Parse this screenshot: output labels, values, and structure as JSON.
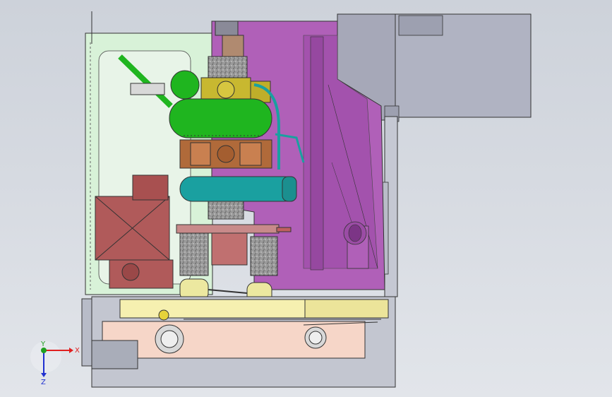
{
  "view": {
    "type": "CAD assembly drawing (side view)",
    "background_top": "#cdd2da",
    "background_bottom": "#e2e5ea"
  },
  "triad": {
    "x_label": "X",
    "y_label": "Y",
    "z_label": "Z",
    "x_color": "#e02020",
    "y_color": "#20a020",
    "z_color": "#2030d0"
  },
  "colors": {
    "frame_green": "#d8f2d8",
    "chamber_purple": "#b060b8",
    "chamber_dark": "#8a3e93",
    "engine_green": "#1fb51f",
    "yellow_block": "#c8b830",
    "copper_block": "#b06a3a",
    "cyan_tank": "#1aa0a0",
    "brick_red": "#b05a5a",
    "base_pink": "#f6d6c8",
    "light_yellow": "#f6f0b0",
    "grey_panel": "#b8bcc8"
  }
}
